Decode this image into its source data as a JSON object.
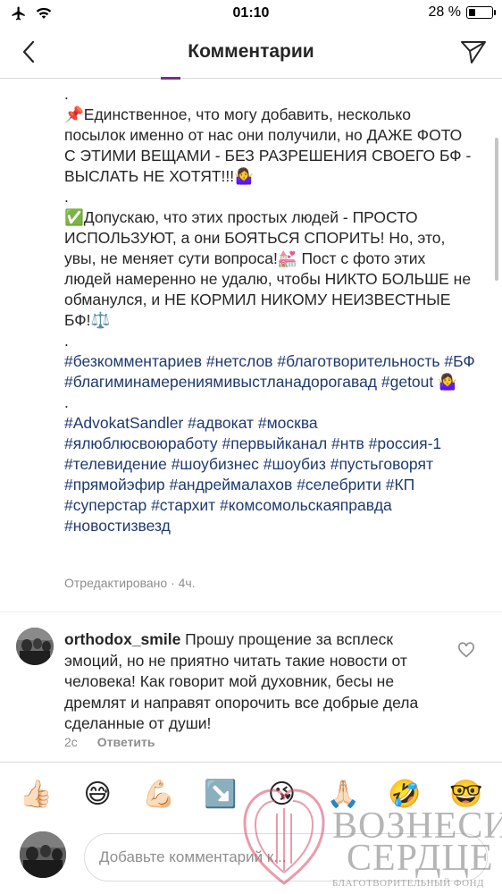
{
  "status_bar": {
    "time": "01:10",
    "battery_text": "28 %",
    "battery_level": 0.28,
    "icons": [
      "airplane-icon",
      "wifi-icon",
      "battery-icon"
    ]
  },
  "nav": {
    "title": "Комментарии",
    "icons": [
      "back-chevron-icon",
      "direct-send-icon"
    ]
  },
  "caption": {
    "paragraphs": [
      ".",
      "📌Единственное, что могу добавить, несколько посылок именно от нас они получили, но ДАЖЕ ФОТО С ЭТИМИ ВЕЩАМИ - БЕЗ РАЗРЕШЕНИЯ СВОЕГО БФ - ВЫСЛАТЬ НЕ ХОТЯТ!!!🤷‍♀️",
      ".",
      "✅Допускаю, что этих простых людей - ПРОСТО ИСПОЛЬЗУЮТ, а они БОЯТЬСЯ СПОРИТЬ! Но, это, увы, не меняет сути вопроса!💒 Пост с фото этих людей намеренно не удалю, чтобы НИКТО БОЛЬШЕ не обманулся, и НЕ КОРМИЛ НИКОМУ НЕИЗВЕСТНЫЕ БФ!⚖️",
      "."
    ],
    "hashtags_1": "#безкомментариев #нетслов #благотворительность #БФ #благиминамерениямивыстланадорогавад #getout 🤷‍♀️",
    "dot_3": ".",
    "hashtags_2": "#AdvokatSandler #адвокат #москва #ялюблюсвоюработу #первыйканал #нтв #россия-1 #телевидение #шоубизнес #шоубиз #пустьговорят #прямойэфир #андреймалахов #селебрити #КП #суперстар #стархит #комсомольскаяправда #новостизвезд",
    "meta": "Отредактировано · 4ч."
  },
  "comment": {
    "username": "orthodox_smile",
    "text": " Прошу прощение за всплеск эмоций, но не приятно читать такие новости от человека! Как говорит мой духовник, бесы не дремлят и направят опорочить все добрые дела сделанные от души!",
    "time": "2с",
    "reply_label": "Ответить"
  },
  "emoji_bar": [
    "👍🏻",
    "😅",
    "💪🏻",
    "↘️",
    "😘",
    "🙏🏻",
    "🤣",
    "🤓"
  ],
  "composer": {
    "placeholder": "Добавьте комментарий к..."
  },
  "watermark": {
    "line1": "ВОЗНЕСИ",
    "line2": "СЕРДЦЕ",
    "line3": "БЛАГОТВОРИТЕЛЬНЫЙ ФОНД"
  }
}
